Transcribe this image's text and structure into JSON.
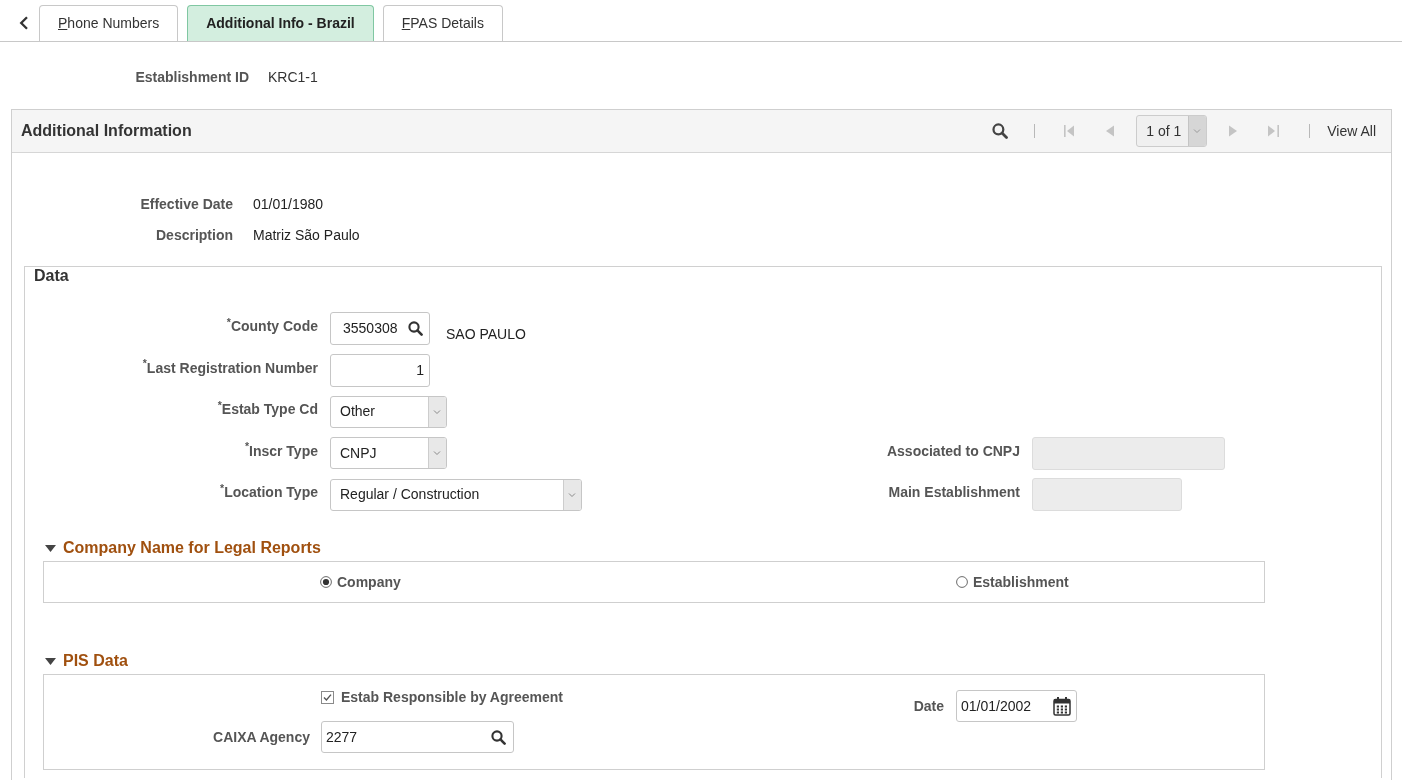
{
  "tabs": [
    {
      "label": "Phone Numbers",
      "selected": false,
      "mnemonic_underlined": true
    },
    {
      "label": "Additional Info - Brazil",
      "selected": true,
      "mnemonic_underlined": false
    },
    {
      "label": "FPAS Details",
      "selected": false,
      "mnemonic_underlined": true
    }
  ],
  "header_fields": [
    {
      "label": "Establishment ID",
      "value": "KRC1-1"
    }
  ],
  "panel": {
    "title": "Additional Information",
    "pager": {
      "position": "1 of 1",
      "view_all": "View All",
      "navigation": [
        {
          "kind": "first",
          "disabled": true
        },
        {
          "kind": "previous",
          "disabled": true
        },
        {
          "kind": "next",
          "disabled": true
        },
        {
          "kind": "last",
          "disabled": true
        }
      ]
    },
    "fields": [
      {
        "label": "Effective Date",
        "value": "01/01/1980"
      },
      {
        "label": "Description",
        "value": "Matriz São Paulo"
      }
    ],
    "data": {
      "title": "Data",
      "rows": [
        {
          "left": {
            "kind": "lookup",
            "label": "$^{*}$County Code",
            "value": "3550308",
            "description": "SAO PAULO"
          }
        },
        {
          "left": {
            "kind": "number",
            "label": "$^{*}$Last Registration Number",
            "value": "1"
          }
        },
        {
          "left": {
            "kind": "select",
            "label": "$^{*}$Estab Type Cd",
            "value": "Other"
          }
        },
        {
          "left": {
            "kind": "select",
            "label": "$^{*}$Inscr Type",
            "value": "CNPJ"
          },
          "right": {
            "kind": "text",
            "label": "Associated to CNPJ",
            "disabled": true
          }
        },
        {
          "left": {
            "kind": "select",
            "label": "$^{*}$Location Type",
            "value": "Regular / Construction"
          },
          "right": {
            "kind": "text",
            "label": "Main Establishment",
            "disabled": true
          }
        }
      ],
      "company_name": {
        "title": "Company Name for Legal Reports",
        "expanded": true,
        "options": [
          {
            "label": "Company",
            "selected": true
          },
          {
            "label": "Establishment",
            "selected": false
          }
        ]
      },
      "pis": {
        "title": "PIS Data",
        "expanded": true,
        "checkbox": {
          "label": "Estab Responsible by Agreement",
          "checked": true
        },
        "caixa_agency": {
          "label": "CAIXA Agency",
          "value": "2277"
        },
        "date": {
          "label": "Date",
          "value": "01/01/2002"
        }
      }
    }
  }
}
